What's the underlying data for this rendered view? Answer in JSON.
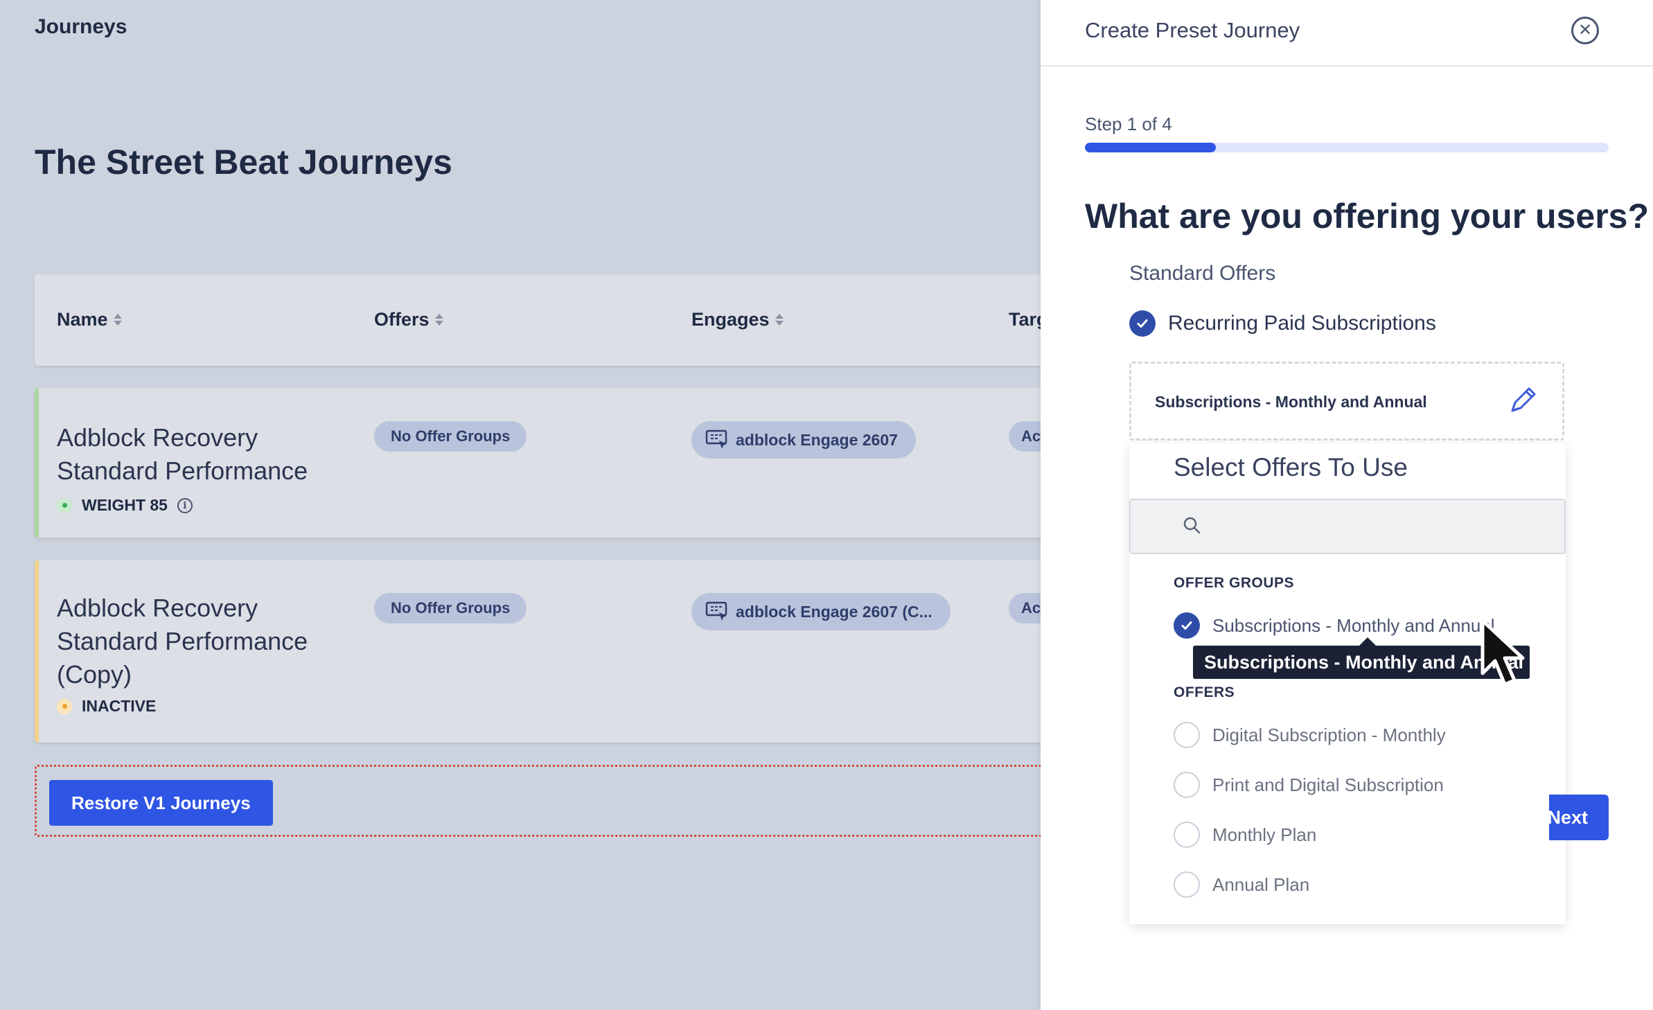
{
  "app": {
    "title": "Journeys"
  },
  "page": {
    "heading": "The Street Beat Journeys"
  },
  "table": {
    "columns": [
      {
        "label": "Name"
      },
      {
        "label": "Offers"
      },
      {
        "label": "Engages"
      },
      {
        "label": "Targ"
      }
    ],
    "rows": [
      {
        "name": "Adblock Recovery Standard Performance",
        "status": "WEIGHT 85",
        "status_color": "#3fae5a",
        "accent_color": "#a9d6a0",
        "offer": "No Offer Groups",
        "engage": "adblock Engage 2607",
        "target": "Ac"
      },
      {
        "name": "Adblock Recovery Standard Performance (Copy)",
        "status": "INACTIVE",
        "status_color": "#e8a431",
        "accent_color": "#f1d38c",
        "offer": "No Offer Groups",
        "engage": "adblock Engage 2607 (C...",
        "target": "Ac"
      }
    ]
  },
  "restore_button": "Restore V1 Journeys",
  "drawer": {
    "title": "Create Preset Journey",
    "step_label": "Step 1 of 4",
    "progress": 0.25,
    "question": "What are you offering your users?",
    "standard_offers_label": "Standard Offers",
    "recurring_label": "Recurring Paid Subscriptions",
    "selected_group": "Subscriptions - Monthly and Annual",
    "next_label": "Next"
  },
  "dropdown": {
    "title": "Select Offers To Use",
    "search_value": "",
    "offer_groups_heading": "OFFER GROUPS",
    "offer_groups": [
      {
        "label": "Subscriptions - Monthly and Annual",
        "checked": true
      }
    ],
    "offers_heading": "OFFERS",
    "offers": [
      {
        "label": "Digital Subscription - Monthly",
        "checked": false
      },
      {
        "label": "Print and Digital Subscription",
        "checked": false
      },
      {
        "label": "Monthly Plan",
        "checked": false
      },
      {
        "label": "Annual Plan",
        "checked": false
      }
    ],
    "tooltip": "Subscriptions - Monthly and Annual"
  },
  "colors": {
    "primary": "#2f55e4",
    "check": "#2f4da8",
    "overlay_bg": "#cdd3de"
  }
}
